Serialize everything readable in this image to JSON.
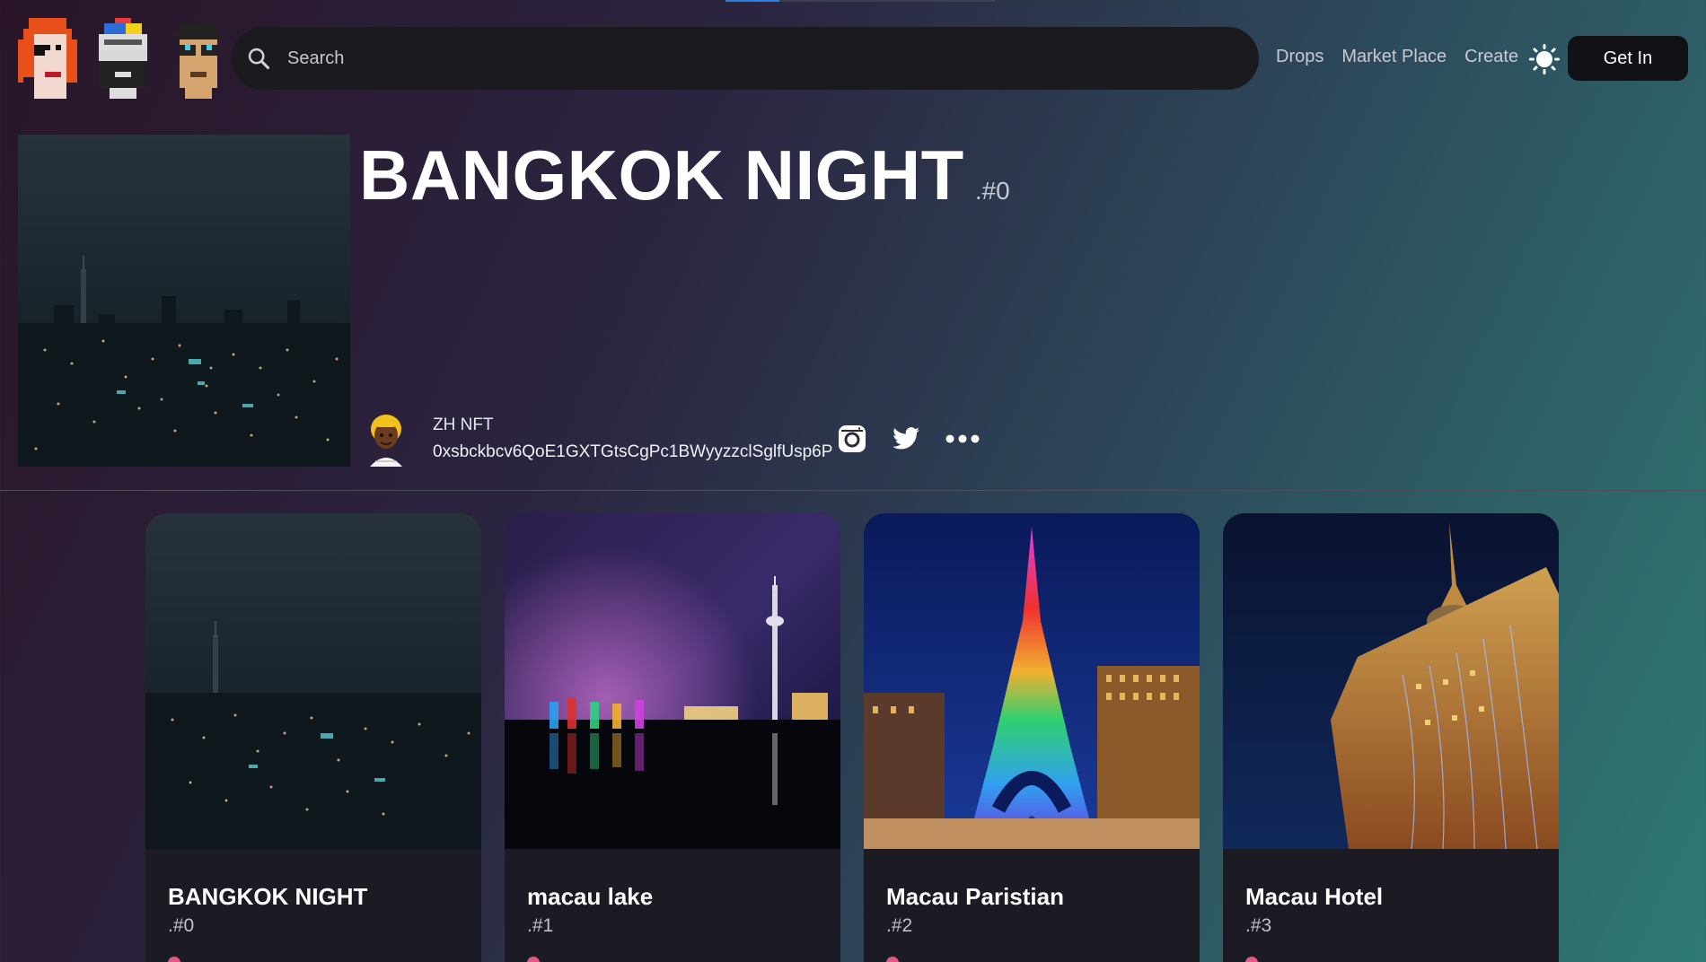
{
  "header": {
    "search_placeholder": "Search",
    "nav": [
      "Drops",
      "Market Place",
      "Create"
    ],
    "get_in_label": "Get In",
    "theme_icon": "sun-icon"
  },
  "hero": {
    "title": "BANGKOK NIGHT",
    "token": ".#0",
    "owner_name": "ZH NFT",
    "owner_address": "0xsbckbcv6QoE1GXTGtsCgPc1BWyyzzclSglfUsp6P",
    "social_icons": [
      "instagram-icon",
      "twitter-icon",
      "more-icon"
    ]
  },
  "cards": [
    {
      "name": "BANGKOK NIGHT",
      "token": ".#0"
    },
    {
      "name": "macau lake",
      "token": ".#1"
    },
    {
      "name": "Macau Paristian",
      "token": ".#2"
    },
    {
      "name": "Macau Hotel",
      "token": ".#3"
    }
  ],
  "colors": {
    "accent_bar": "#2f7fe0",
    "card_bg": "#1c1b24",
    "heart": "#e05a87"
  }
}
